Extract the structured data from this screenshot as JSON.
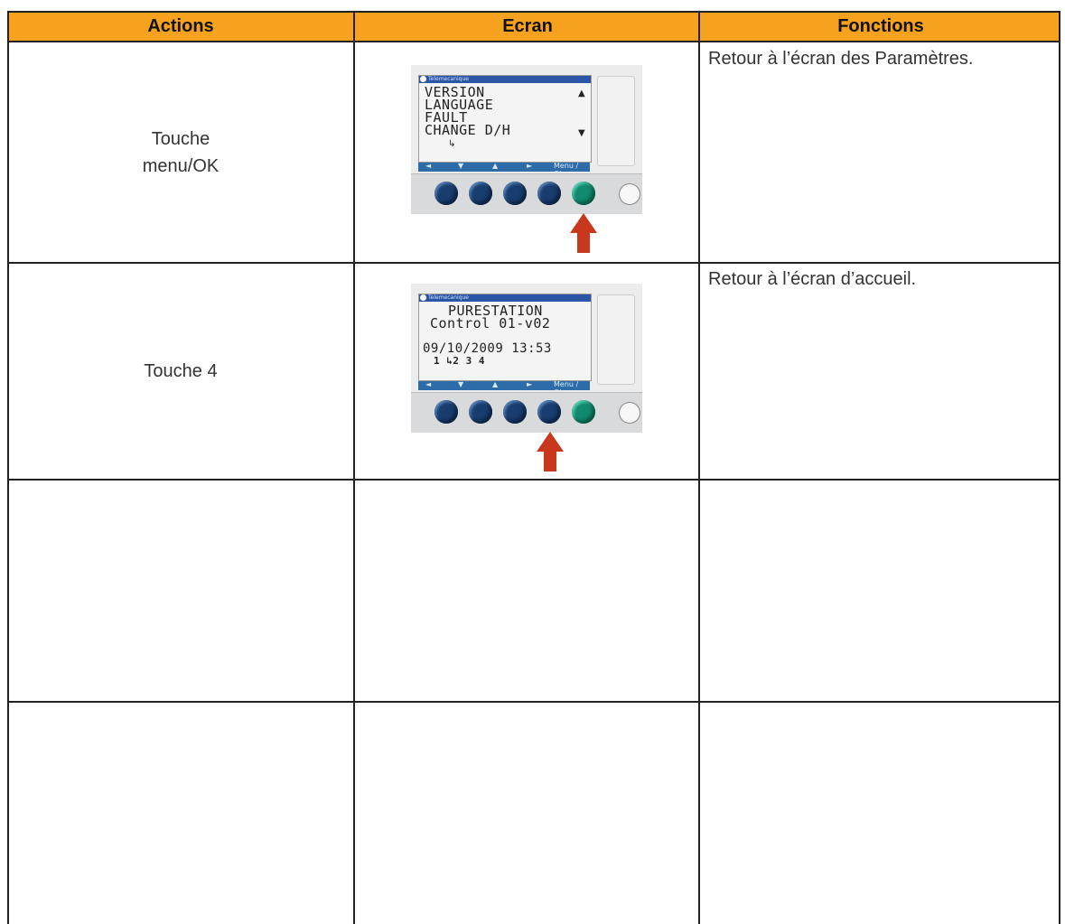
{
  "table": {
    "headers": [
      "Actions",
      "Ecran",
      "Fonctions"
    ],
    "rows": [
      {
        "action": "Touche\nmenu/OK",
        "function": "Retour à l’écran des Paramètres.",
        "screen": {
          "lines": [
            "VERSION",
            "LANGUAGE",
            "FAULT",
            "CHANGE  D/H"
          ],
          "nav_labels": [
            "◄",
            "▼",
            "▲",
            "►",
            "Menu / Ok"
          ],
          "highlighted_button": "menu-ok"
        }
      },
      {
        "action": "Touche 4",
        "function": "Retour à l’écran d’accueil.",
        "screen": {
          "lines": [
            "PURESTATION",
            "Control 01-v02",
            "",
            "09/10/2009    13:53",
            "1 ↳2  3  4"
          ],
          "nav_labels": [
            "◄",
            "▼",
            "▲",
            "►",
            "Menu / Ok"
          ],
          "highlighted_button": "button-4"
        }
      },
      {
        "action": "",
        "function": ""
      },
      {
        "action": "",
        "function": ""
      }
    ]
  }
}
